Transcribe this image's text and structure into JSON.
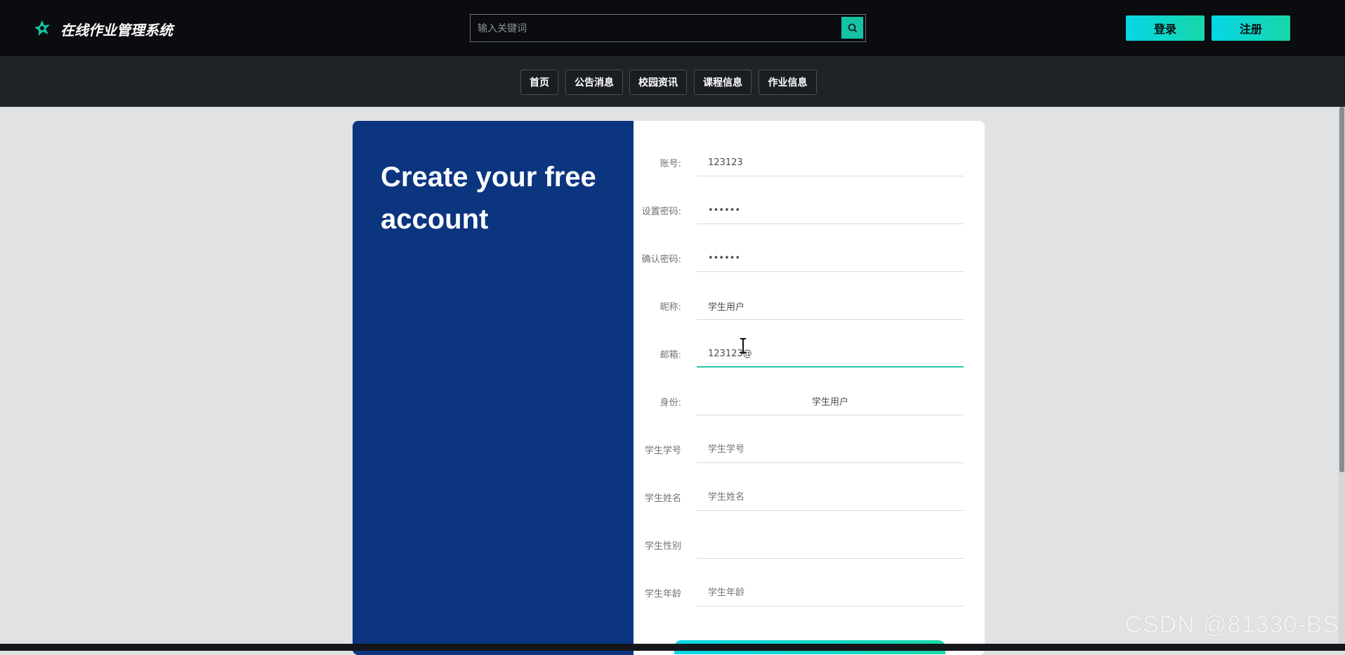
{
  "header": {
    "app_title": "在线作业管理系统",
    "search_placeholder": "输入关键词",
    "login_label": "登录",
    "register_label": "注册"
  },
  "nav": {
    "items": [
      {
        "label": "首页"
      },
      {
        "label": "公告消息"
      },
      {
        "label": "校园资讯"
      },
      {
        "label": "课程信息"
      },
      {
        "label": "作业信息"
      }
    ]
  },
  "form": {
    "heading": "Create your free account",
    "fields": [
      {
        "label": "账号:",
        "value": "123123",
        "placeholder": ""
      },
      {
        "label": "设置密码:",
        "value": "••••••",
        "placeholder": ""
      },
      {
        "label": "确认密码:",
        "value": "••••••",
        "placeholder": ""
      },
      {
        "label": "昵称:",
        "value": "学生用户",
        "placeholder": ""
      },
      {
        "label": "邮箱:",
        "value": "123123@",
        "placeholder": ""
      },
      {
        "label": "身份:",
        "value": "学生用户",
        "placeholder": ""
      },
      {
        "label": "学生学号",
        "value": "",
        "placeholder": "学生学号"
      },
      {
        "label": "学生姓名",
        "value": "",
        "placeholder": "学生姓名"
      },
      {
        "label": "学生性别",
        "value": "",
        "placeholder": ""
      },
      {
        "label": "学生年龄",
        "value": "",
        "placeholder": "学生年龄"
      }
    ]
  },
  "watermark": "CSDN @81330-BS",
  "colors": {
    "accent": "#13c3a3",
    "panel_blue": "#0c3580",
    "topbar": "#0a0c10"
  }
}
